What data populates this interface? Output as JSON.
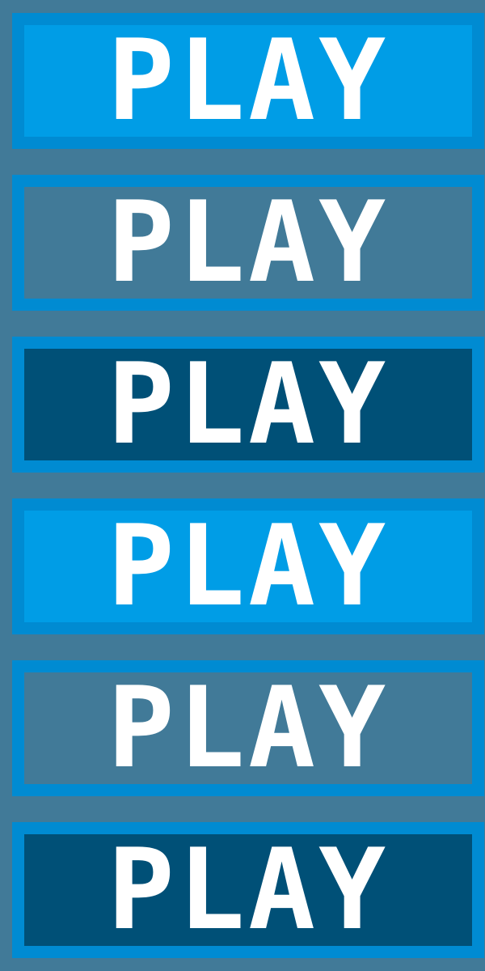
{
  "buttons": [
    {
      "label": "PLAY",
      "variant": "normal"
    },
    {
      "label": "PLAY",
      "variant": "hover"
    },
    {
      "label": "PLAY",
      "variant": "pressed"
    },
    {
      "label": "PLAY",
      "variant": "normal"
    },
    {
      "label": "PLAY",
      "variant": "hover"
    },
    {
      "label": "PLAY",
      "variant": "pressed"
    }
  ],
  "colors": {
    "background": "#417A98",
    "border": "#008BD2",
    "normal_fill": "#009DE6",
    "hover_fill": "#417A98",
    "pressed_fill": "#005077",
    "text": "#FFFFFF"
  }
}
